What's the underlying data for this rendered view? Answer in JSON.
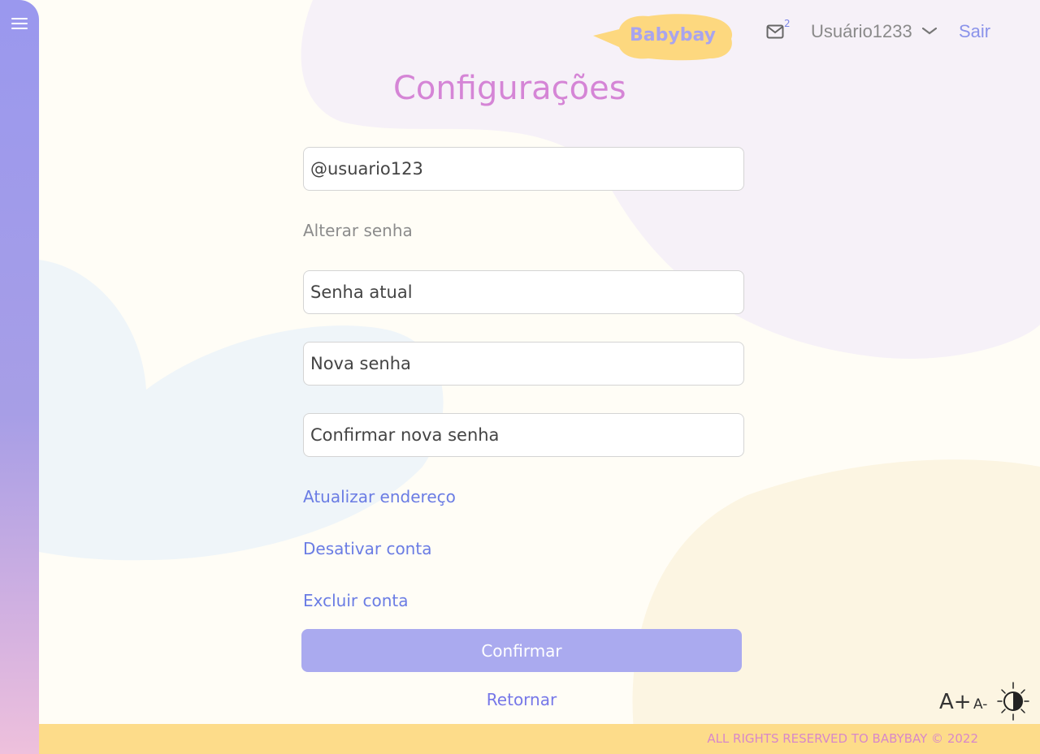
{
  "header": {
    "logo_text": "Babybay",
    "mail_count": "2",
    "username": "Usuário1233",
    "logout_label": "Sair"
  },
  "main": {
    "title": "Configurações",
    "username_field": "@usuario123",
    "change_password_label": "Alterar senha",
    "current_password_placeholder": "Senha atual",
    "new_password_placeholder": "Nova senha",
    "confirm_password_placeholder": "Confirmar nova senha",
    "update_address_link": "Atualizar endereço",
    "deactivate_link": "Desativar conta",
    "delete_link": "Excluir conta",
    "confirm_button": "Confirmar",
    "back_link": "Retornar"
  },
  "accessibility": {
    "increase_font": "A+",
    "decrease_font": "A-"
  },
  "footer": {
    "copyright": "ALL RIGHTS RESERVED TO BABYBAY © 2022"
  },
  "colors": {
    "sidebar": "#9a98ee",
    "title": "#d585d6",
    "link": "#6a7ce4",
    "button": "#aaaaef",
    "footer": "#fddc8a",
    "logo_cloud": "#fdd87f"
  }
}
